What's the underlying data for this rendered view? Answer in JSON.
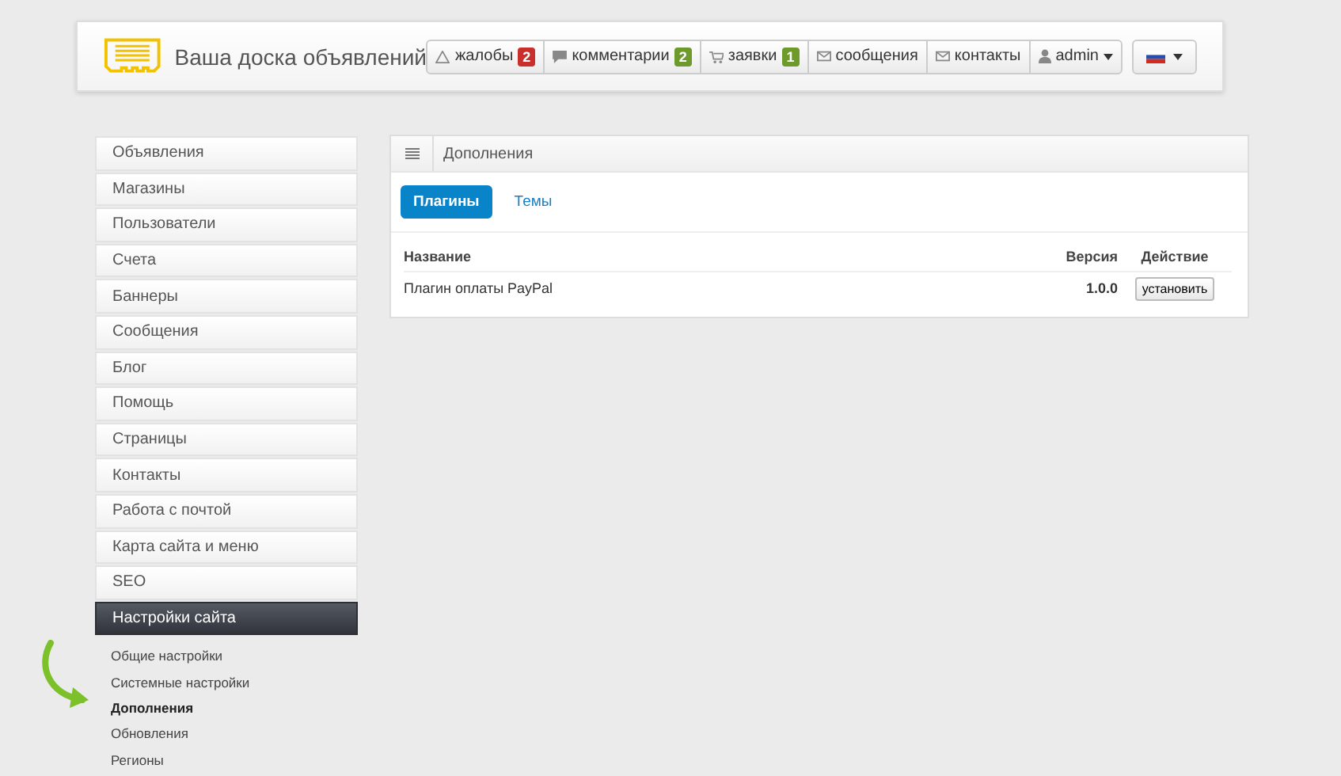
{
  "header": {
    "site_title": "Ваша доска объявлений",
    "nav": [
      {
        "kind": "alerts",
        "label": "жалобы",
        "badge": "2",
        "color": "#c9302c"
      },
      {
        "kind": "comments",
        "label": "комментарии",
        "badge": "2",
        "color": "#6d9a2a"
      },
      {
        "kind": "orders",
        "label": "заявки",
        "badge": "1",
        "color": "#6d9a2a"
      },
      {
        "kind": "messages",
        "label": "сообщения"
      },
      {
        "kind": "contacts",
        "label": "контакты"
      },
      {
        "kind": "user",
        "label": "admin",
        "dropdown": true
      }
    ],
    "language": {
      "dropdown": true
    }
  },
  "sidebar": {
    "items": [
      {
        "label": "Объявления",
        "selected": false
      },
      {
        "label": "Магазины",
        "selected": false
      },
      {
        "label": "Пользователи",
        "selected": false
      },
      {
        "label": "Счета",
        "selected": false
      },
      {
        "label": "Баннеры",
        "selected": false
      },
      {
        "label": "Сообщения",
        "selected": false
      },
      {
        "label": "Блог",
        "selected": false
      },
      {
        "label": "Помощь",
        "selected": false
      },
      {
        "label": "Страницы",
        "selected": false
      },
      {
        "label": "Контакты",
        "selected": false
      },
      {
        "label": "Работа с почтой",
        "selected": false
      },
      {
        "label": "Карта сайта и меню",
        "selected": false
      },
      {
        "label": "SEO",
        "selected": false
      },
      {
        "label": "Настройки сайта",
        "selected": true,
        "children": [
          {
            "label": "Общие настройки",
            "selected": false
          },
          {
            "label": "Системные настройки",
            "selected": false
          },
          {
            "label": "Дополнения",
            "selected": true
          },
          {
            "label": "Обновления",
            "selected": false
          },
          {
            "label": "Регионы",
            "selected": false
          }
        ]
      }
    ]
  },
  "panel": {
    "title": "Дополнения",
    "tabs": [
      {
        "label": "Плагины",
        "selected": true
      },
      {
        "label": "Темы",
        "selected": false
      }
    ],
    "table": {
      "columns": [
        "Название",
        "Версия",
        "Действие"
      ],
      "rows": [
        {
          "name": "Плагин оплаты PayPal",
          "version": "1.0.0",
          "action": "установить"
        }
      ]
    }
  }
}
